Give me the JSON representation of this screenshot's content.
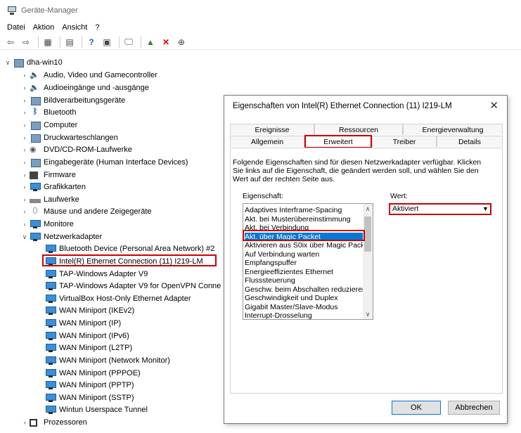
{
  "window": {
    "title": "Geräte-Manager"
  },
  "menu": [
    "Datei",
    "Aktion",
    "Ansicht",
    "?"
  ],
  "tree": {
    "root": "dha-win10",
    "categories": [
      "Audio, Video und Gamecontroller",
      "Audioeingänge und -ausgänge",
      "Bildverarbeitungsgeräte",
      "Bluetooth",
      "Computer",
      "Druckwarteschlangen",
      "DVD/CD-ROM-Laufwerke",
      "Eingabegeräte (Human Interface Devices)",
      "Firmware",
      "Grafikkarten",
      "Laufwerke",
      "Mäuse und andere Zeigegeräte",
      "Monitore",
      "Netzwerkadapter"
    ],
    "network_adapters": [
      "Bluetooth Device (Personal Area Network) #2",
      "Intel(R) Ethernet Connection (11) I219-LM",
      "TAP-Windows Adapter V9",
      "TAP-Windows Adapter V9 for OpenVPN Conne",
      "VirtualBox Host-Only Ethernet Adapter",
      "WAN Miniport (IKEv2)",
      "WAN Miniport (IP)",
      "WAN Miniport (IPv6)",
      "WAN Miniport (L2TP)",
      "WAN Miniport (Network Monitor)",
      "WAN Miniport (PPPOE)",
      "WAN Miniport (PPTP)",
      "WAN Miniport (SSTP)",
      "Wintun Userspace Tunnel"
    ],
    "last_category": "Prozessoren"
  },
  "dialog": {
    "title": "Eigenschaften von Intel(R) Ethernet Connection (11) I219-LM",
    "tabs_row1": [
      "Ereignisse",
      "Ressourcen",
      "Energieverwaltung"
    ],
    "tabs_row2": [
      "Allgemein",
      "Erweitert",
      "Treiber",
      "Details"
    ],
    "active_tab": "Erweitert",
    "description": "Folgende Eigenschaften sind für diesen Netzwerkadapter verfügbar. Klicken Sie links auf die Eigenschaft, die geändert werden soll, und wählen Sie den Wert auf der rechten Seite aus.",
    "property_label": "Eigenschaft:",
    "value_label": "Wert:",
    "properties": [
      "Adaptives Interframe-Spacing",
      "Akt. bei Musterübereinstimmung",
      "Akt. bei Verbindung",
      "Akt. über Magic Packet",
      "Aktivieren aus S0ix über Magic Pack",
      "Auf Verbindung warten",
      "Empfangspuffer",
      "Energieeffizientes Ethernet",
      "Flusssteuerung",
      "Geschw. beim Abschalten reduzieren",
      "Geschwindigkeit und Duplex",
      "Gigabit Master/Slave-Modus",
      "Interrupt-Drosselung"
    ],
    "selected_property": "Akt. über Magic Packet",
    "value": "Aktiviert",
    "ok_label": "OK",
    "cancel_label": "Abbrechen"
  }
}
